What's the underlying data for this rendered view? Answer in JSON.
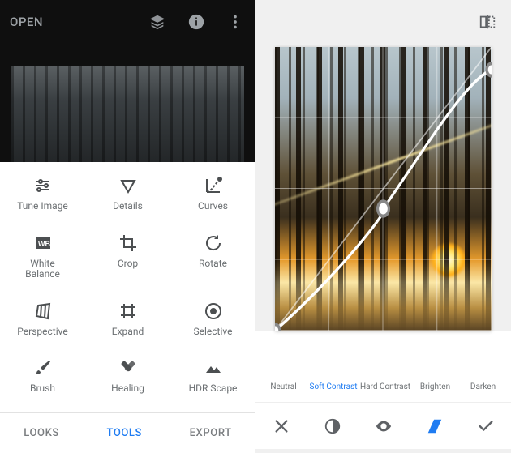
{
  "left": {
    "topbar": {
      "open_label": "OPEN",
      "icons": {
        "stacks": "stacks-icon",
        "info": "info-icon",
        "more": "more-vertical-icon"
      }
    },
    "tools": [
      {
        "id": "tune-image",
        "label": "Tune Image",
        "icon": "tune-icon"
      },
      {
        "id": "details",
        "label": "Details",
        "icon": "triangle-down-icon"
      },
      {
        "id": "curves",
        "label": "Curves",
        "icon": "curves-icon"
      },
      {
        "id": "white-balance",
        "label": "White\nBalance",
        "icon": "white-balance-icon"
      },
      {
        "id": "crop",
        "label": "Crop",
        "icon": "crop-icon"
      },
      {
        "id": "rotate",
        "label": "Rotate",
        "icon": "rotate-icon"
      },
      {
        "id": "perspective",
        "label": "Perspective",
        "icon": "perspective-icon"
      },
      {
        "id": "expand",
        "label": "Expand",
        "icon": "expand-icon"
      },
      {
        "id": "selective",
        "label": "Selective",
        "icon": "selective-icon"
      },
      {
        "id": "brush",
        "label": "Brush",
        "icon": "brush-icon"
      },
      {
        "id": "healing",
        "label": "Healing",
        "icon": "healing-icon"
      },
      {
        "id": "hdr-scape",
        "label": "HDR Scape",
        "icon": "hdr-scape-icon"
      }
    ],
    "tabs": {
      "looks": "LOOKS",
      "tools": "TOOLS",
      "export": "EXPORT",
      "active": "tools"
    }
  },
  "right": {
    "topbar": {
      "compare_icon": "compare-icon"
    },
    "curve": {
      "grid_divisions": 4,
      "control_points": [
        {
          "x": 0.0,
          "y": 0.0
        },
        {
          "x": 0.5,
          "y": 0.43
        },
        {
          "x": 1.0,
          "y": 0.92
        }
      ]
    },
    "presets": [
      {
        "id": "neutral",
        "label": "Neutral",
        "selected": false
      },
      {
        "id": "soft-contrast",
        "label": "Soft Contrast",
        "selected": true
      },
      {
        "id": "hard-contrast",
        "label": "Hard Contrast",
        "selected": false
      },
      {
        "id": "brighten",
        "label": "Brighten",
        "selected": false
      },
      {
        "id": "darken",
        "label": "Darken",
        "selected": false
      }
    ],
    "action_bar": {
      "cancel": "close-icon",
      "channel_luma": "luminance-channel-icon",
      "channel_eye": "visibility-icon",
      "channel_sel": "channel-icon",
      "confirm": "check-icon",
      "selected": "channel_sel"
    }
  },
  "colors": {
    "accent": "#1f7cf2",
    "muted_text": "#6b6f72",
    "icon": "#4c4f51"
  }
}
